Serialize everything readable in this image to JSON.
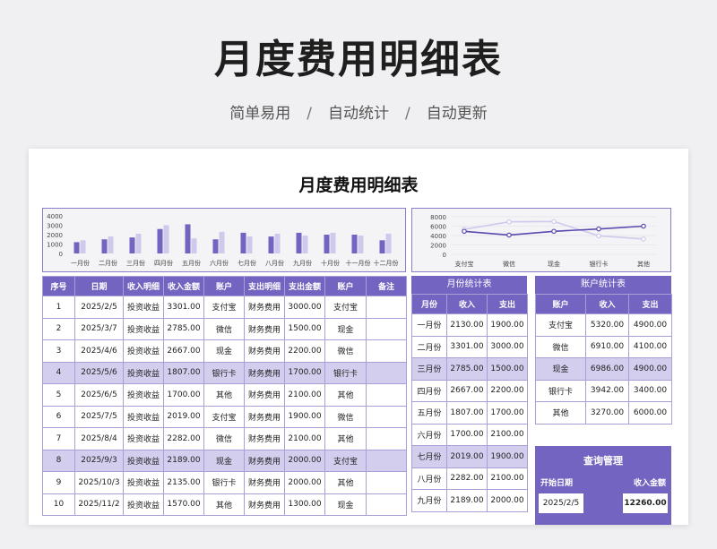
{
  "hero": {
    "title": "月度费用明细表",
    "tags": [
      "简单易用",
      "自动统计",
      "自动更新"
    ],
    "separator": "/"
  },
  "sheet": {
    "title": "月度费用明细表"
  },
  "chart_data": [
    {
      "type": "bar",
      "categories": [
        "一月份",
        "二月份",
        "三月份",
        "四月份",
        "五月份",
        "六月份",
        "七月份",
        "八月份",
        "九月份",
        "十月份",
        "十一月份",
        "十二月份"
      ],
      "ylim": [
        0,
        4000
      ],
      "yticks": [
        0,
        1000,
        2000,
        3000,
        4000
      ],
      "series": [
        {
          "values": [
            1200,
            1500,
            1700,
            2600,
            3100,
            1500,
            2200,
            1800,
            2200,
            2000,
            2000,
            1400
          ]
        },
        {
          "values": [
            1400,
            1800,
            2100,
            3000,
            1600,
            2300,
            1800,
            2100,
            1900,
            2200,
            1900,
            2100
          ]
        }
      ],
      "colors": [
        "#7264c0",
        "#cfc9ec"
      ]
    },
    {
      "type": "line",
      "categories": [
        "支付宝",
        "微信",
        "现金",
        "银行卡",
        "其他"
      ],
      "ylim": [
        0,
        8000
      ],
      "yticks": [
        0,
        2000,
        4000,
        6000,
        8000
      ],
      "series": [
        {
          "values": [
            5320,
            6910,
            6986,
            3942,
            3270
          ]
        },
        {
          "values": [
            4900,
            4100,
            4900,
            5400,
            6000
          ]
        }
      ],
      "colors": [
        "#cfc9ec",
        "#5a4bb0"
      ]
    }
  ],
  "main_table": {
    "headers": [
      "序号",
      "日期",
      "收入明细",
      "收入金额",
      "账户",
      "支出明细",
      "支出金额",
      "账户",
      "备注"
    ],
    "rows": [
      [
        "1",
        "2025/2/5",
        "投资收益",
        "3301.00",
        "支付宝",
        "财务费用",
        "3000.00",
        "支付宝",
        ""
      ],
      [
        "2",
        "2025/3/7",
        "投资收益",
        "2785.00",
        "微信",
        "财务费用",
        "1500.00",
        "现金",
        ""
      ],
      [
        "3",
        "2025/4/6",
        "投资收益",
        "2667.00",
        "现金",
        "财务费用",
        "2200.00",
        "微信",
        ""
      ],
      [
        "4",
        "2025/5/6",
        "投资收益",
        "1807.00",
        "银行卡",
        "财务费用",
        "1700.00",
        "银行卡",
        ""
      ],
      [
        "5",
        "2025/6/5",
        "投资收益",
        "1700.00",
        "其他",
        "财务费用",
        "2100.00",
        "其他",
        ""
      ],
      [
        "6",
        "2025/7/5",
        "投资收益",
        "2019.00",
        "支付宝",
        "财务费用",
        "1900.00",
        "微信",
        ""
      ],
      [
        "7",
        "2025/8/4",
        "投资收益",
        "2282.00",
        "微信",
        "财务费用",
        "2100.00",
        "其他",
        ""
      ],
      [
        "8",
        "2025/9/3",
        "投资收益",
        "2189.00",
        "现金",
        "财务费用",
        "2000.00",
        "支付宝",
        ""
      ],
      [
        "9",
        "2025/10/3",
        "投资收益",
        "2135.00",
        "银行卡",
        "财务费用",
        "2000.00",
        "其他",
        ""
      ],
      [
        "10",
        "2025/11/2",
        "投资收益",
        "1570.00",
        "其他",
        "财务费用",
        "1300.00",
        "现金",
        ""
      ]
    ]
  },
  "month_table": {
    "caption": "月份统计表",
    "headers": [
      "月份",
      "收入",
      "支出"
    ],
    "rows": [
      [
        "一月份",
        "2130.00",
        "1900.00"
      ],
      [
        "二月份",
        "3301.00",
        "3000.00"
      ],
      [
        "三月份",
        "2785.00",
        "1500.00"
      ],
      [
        "四月份",
        "2667.00",
        "2200.00"
      ],
      [
        "五月份",
        "1807.00",
        "1700.00"
      ],
      [
        "六月份",
        "1700.00",
        "2100.00"
      ],
      [
        "七月份",
        "2019.00",
        "1900.00"
      ],
      [
        "八月份",
        "2282.00",
        "2100.00"
      ],
      [
        "九月份",
        "2189.00",
        "2000.00"
      ]
    ]
  },
  "account_table": {
    "caption": "账户统计表",
    "headers": [
      "账户",
      "收入",
      "支出"
    ],
    "rows": [
      [
        "支付宝",
        "5320.00",
        "4900.00"
      ],
      [
        "微信",
        "6910.00",
        "4100.00"
      ],
      [
        "现金",
        "6986.00",
        "4900.00"
      ],
      [
        "银行卡",
        "3942.00",
        "3400.00"
      ],
      [
        "其他",
        "3270.00",
        "6000.00"
      ]
    ]
  },
  "query": {
    "title": "查询管理",
    "start_label": "开始日期",
    "income_label": "收入金额",
    "start_value": "2025/2/5",
    "income_value": "12260.00"
  }
}
